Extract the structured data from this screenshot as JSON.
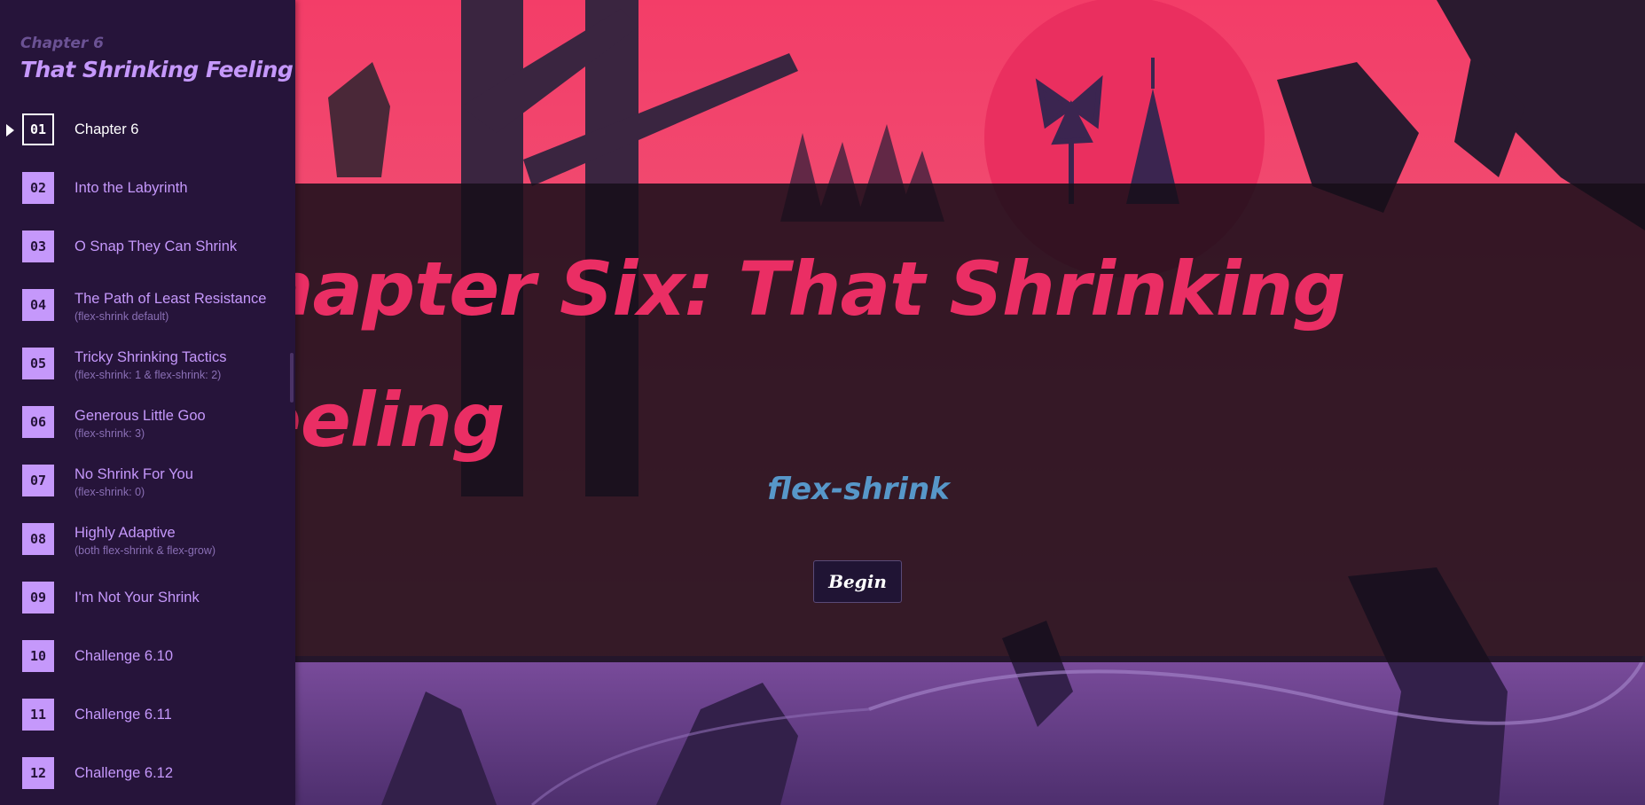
{
  "sidebar": {
    "chapter_label": "Chapter 6",
    "chapter_title": "That Shrinking Feeling",
    "active_index": 0,
    "items": [
      {
        "num": "01",
        "label": "Chapter 6",
        "sub": ""
      },
      {
        "num": "02",
        "label": "Into the Labyrinth",
        "sub": ""
      },
      {
        "num": "03",
        "label": "O Snap They Can Shrink",
        "sub": ""
      },
      {
        "num": "04",
        "label": "The Path of Least Resistance",
        "sub": "(flex-shrink default)"
      },
      {
        "num": "05",
        "label": "Tricky Shrinking Tactics",
        "sub": "(flex-shrink: 1 & flex-shrink: 2)"
      },
      {
        "num": "06",
        "label": "Generous Little Goo",
        "sub": "(flex-shrink: 3)"
      },
      {
        "num": "07",
        "label": "No Shrink For You",
        "sub": "(flex-shrink: 0)"
      },
      {
        "num": "08",
        "label": "Highly Adaptive",
        "sub": "(both flex-shrink & flex-grow)"
      },
      {
        "num": "09",
        "label": "I'm Not Your Shrink",
        "sub": ""
      },
      {
        "num": "10",
        "label": "Challenge 6.10",
        "sub": ""
      },
      {
        "num": "11",
        "label": "Challenge 6.11",
        "sub": ""
      },
      {
        "num": "12",
        "label": "Challenge 6.12",
        "sub": ""
      }
    ]
  },
  "banner": {
    "title": "Chapter Six: That Shrinking Feeling",
    "subtitle": "flex-shrink",
    "begin_label": "Begin"
  },
  "colors": {
    "sidebar_bg": "#26143a",
    "accent_purple": "#c598fb",
    "title_pink": "#ea2e64",
    "subtitle_blue": "#5797c9",
    "sky_top": "#f0436a",
    "sky_bottom": "#e0587a",
    "ground_purple": "#5b3c7e"
  }
}
